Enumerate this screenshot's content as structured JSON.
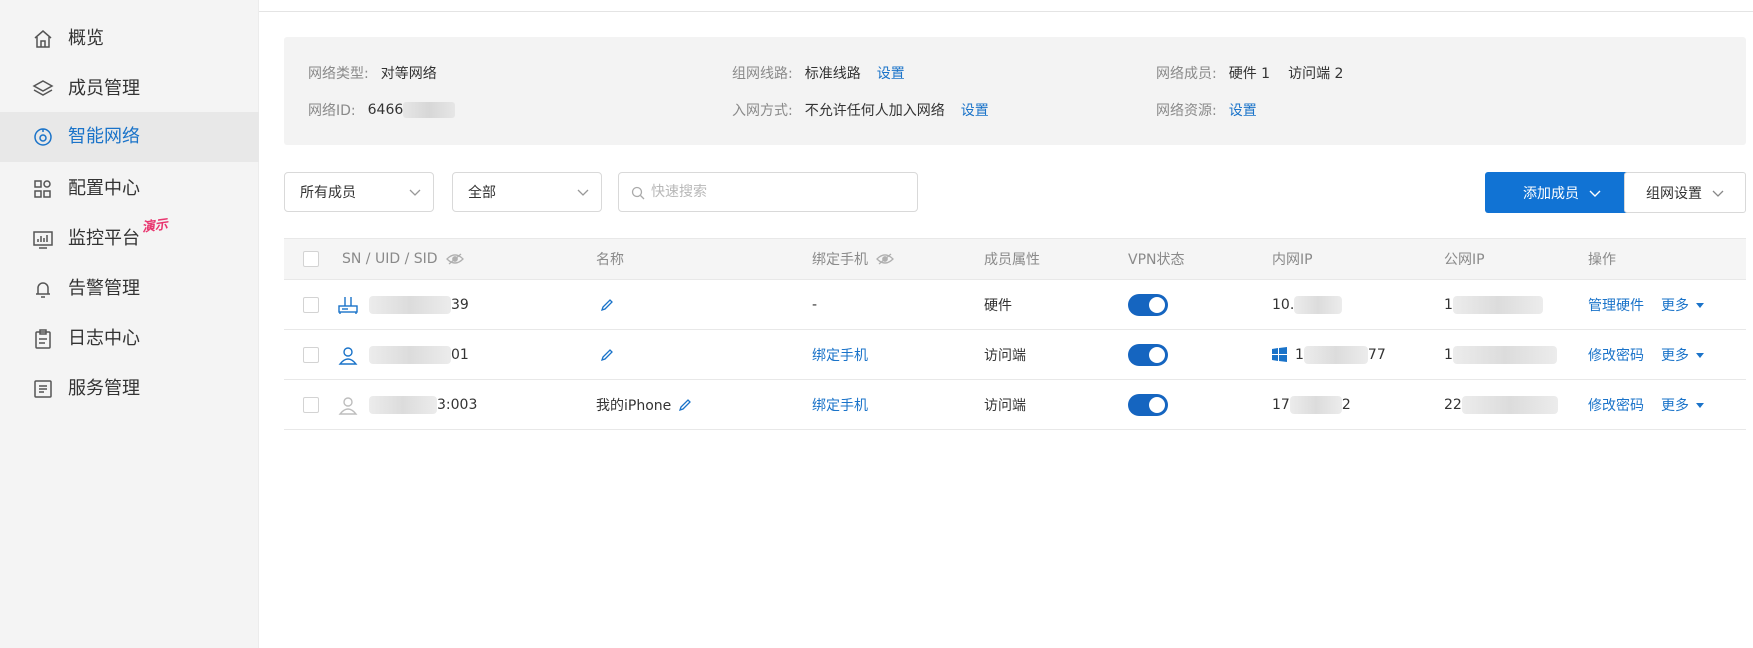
{
  "sidebar": {
    "items": [
      {
        "label": "概览",
        "icon": "home-icon"
      },
      {
        "label": "成员管理",
        "icon": "layers-icon"
      },
      {
        "label": "智能网络",
        "icon": "network-icon",
        "active": true
      },
      {
        "label": "配置中心",
        "icon": "grid-icon"
      },
      {
        "label": "监控平台",
        "icon": "monitor-icon",
        "badge": "演示"
      },
      {
        "label": "告警管理",
        "icon": "bell-icon"
      },
      {
        "label": "日志中心",
        "icon": "clipboard-icon"
      },
      {
        "label": "服务管理",
        "icon": "list-icon"
      }
    ]
  },
  "info": {
    "network_type_label": "网络类型:",
    "network_type_value": "对等网络",
    "network_id_label": "网络ID:",
    "network_id_value": "6466",
    "route_label": "组网线路:",
    "route_value": "标准线路",
    "route_link": "设置",
    "join_label": "入网方式:",
    "join_value": "不允许任何人加入网络",
    "join_link": "设置",
    "members_label": "网络成员:",
    "members_hw": "硬件 1",
    "members_client": "访问端 2",
    "resource_label": "网络资源:",
    "resource_link": "设置"
  },
  "toolbar": {
    "filter_member": "所有成员",
    "filter_status": "全部",
    "search_placeholder": "快速搜索",
    "add_member": "添加成员",
    "network_settings": "组网设置"
  },
  "table": {
    "headers": {
      "sn": "SN / UID / SID",
      "name": "名称",
      "phone": "绑定手机",
      "attr": "成员属性",
      "vpn": "VPN状态",
      "lan_ip": "内网IP",
      "wan_ip": "公网IP",
      "action": "操作"
    },
    "rows": [
      {
        "sn_suffix": "39",
        "name": "",
        "phone": "-",
        "attr": "硬件",
        "vpn_on": true,
        "lan_prefix": "10.",
        "lan_suffix": "",
        "wan_prefix": "1",
        "action": "管理硬件",
        "more": "更多"
      },
      {
        "sn_suffix": "01",
        "name": "",
        "phone": "绑定手机",
        "attr": "访问端",
        "vpn_on": true,
        "lan_prefix": "1",
        "lan_suffix": "77",
        "wan_prefix": "1",
        "action": "修改密码",
        "more": "更多"
      },
      {
        "sn_suffix": "3:003",
        "name": "我的iPhone",
        "phone": "绑定手机",
        "attr": "访问端",
        "vpn_on": true,
        "lan_prefix": "17",
        "lan_suffix": "2",
        "wan_prefix": "22",
        "action": "修改密码",
        "more": "更多"
      }
    ]
  },
  "colors": {
    "accent": "#1a73c9",
    "primary_button": "#1173d4",
    "toggle_on": "#1565c0",
    "demo_badge": "#e8366f"
  }
}
